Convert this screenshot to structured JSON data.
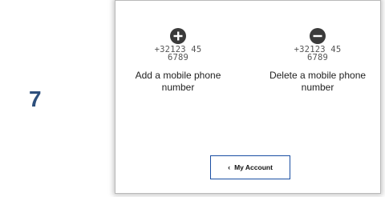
{
  "step": {
    "number": "7"
  },
  "options": {
    "add": {
      "icon": "plus-circle-icon",
      "phone": "+32123 456789",
      "label": "Add a mobile phone number"
    },
    "delete": {
      "icon": "minus-circle-icon",
      "phone": "+32123 456789",
      "label": "Delete a mobile phone number"
    }
  },
  "back": {
    "icon": "chevron-left-icon",
    "chevron": "‹",
    "label": "My Account"
  },
  "colors": {
    "step_number": "#2d4f7c",
    "icon": "#3a3a3a",
    "button_border": "#1a4fa3"
  }
}
